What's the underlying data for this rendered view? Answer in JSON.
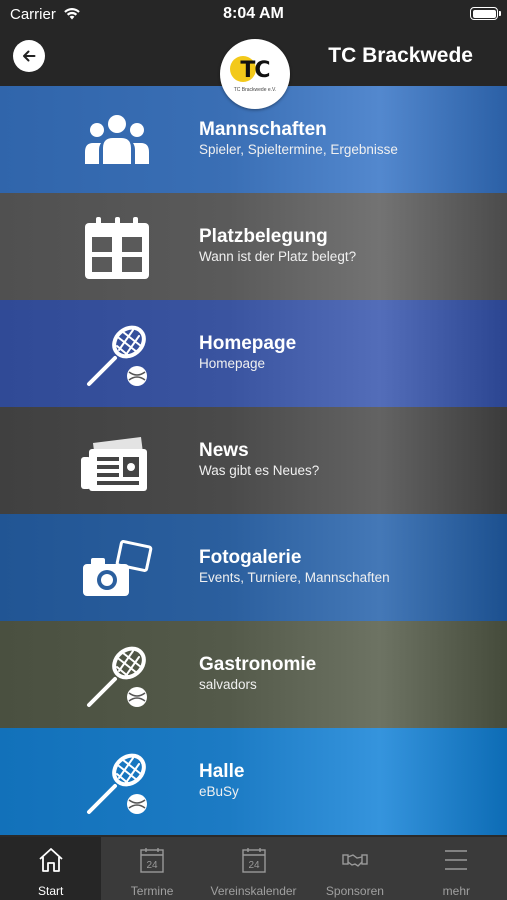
{
  "status": {
    "carrier": "Carrier",
    "time": "8:04 AM"
  },
  "header": {
    "title": "TC Brackwede",
    "logo_text": "TC",
    "logo_sub": "TC Brackwede e.V."
  },
  "menu": [
    {
      "title": "Mannschaften",
      "subtitle": "Spieler, Spieltermine, Ergebnisse",
      "icon": "team-icon",
      "color": "#3a6fb5"
    },
    {
      "title": "Platzbelegung",
      "subtitle": "Wann ist der Platz belegt?",
      "icon": "calendar-icon",
      "color": "#5a5a5a"
    },
    {
      "title": "Homepage",
      "subtitle": "Homepage",
      "icon": "tennis-racket-icon",
      "color": "#3a54a0"
    },
    {
      "title": "News",
      "subtitle": "Was gibt es Neues?",
      "icon": "newspaper-icon",
      "color": "#4a4a4a"
    },
    {
      "title": "Fotogalerie",
      "subtitle": "Events, Turniere, Mannschaften",
      "icon": "camera-photos-icon",
      "color": "#2b5f9e"
    },
    {
      "title": "Gastronomie",
      "subtitle": "salvadors",
      "icon": "tennis-racket-icon",
      "color": "#545a4a"
    },
    {
      "title": "Halle",
      "subtitle": "eBuSy",
      "icon": "tennis-racket-icon",
      "color": "#1c7bc4"
    }
  ],
  "tabs": [
    {
      "label": "Start",
      "icon": "home-icon",
      "active": true
    },
    {
      "label": "Termine",
      "icon": "calendar-24-icon",
      "active": false,
      "day": "24"
    },
    {
      "label": "Vereinskalender",
      "icon": "calendar-24-icon",
      "active": false,
      "day": "24"
    },
    {
      "label": "Sponsoren",
      "icon": "handshake-icon",
      "active": false
    },
    {
      "label": "mehr",
      "icon": "menu-lines-icon",
      "active": false
    }
  ]
}
